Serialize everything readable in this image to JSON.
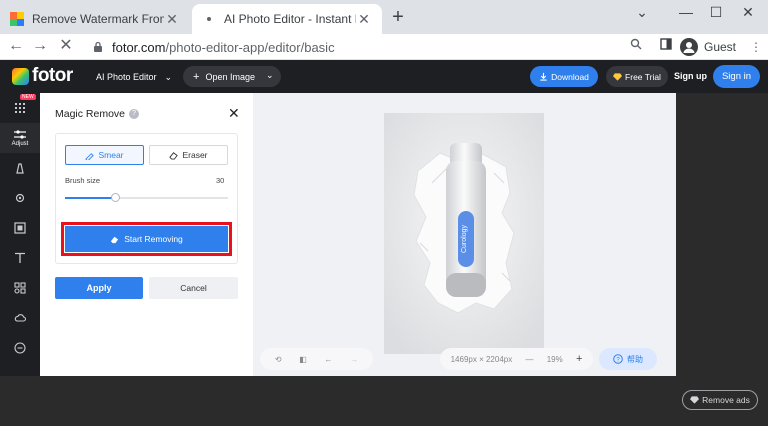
{
  "browser": {
    "tabs": [
      {
        "title": "Remove Watermark From Photo",
        "active": false
      },
      {
        "title": "AI Photo Editor - Instant Photo E",
        "active": true
      }
    ],
    "new_tab": "+",
    "window_controls": {
      "chevron": "⌄",
      "minimize": "—",
      "maximize": "☐",
      "close": "✕"
    },
    "address": {
      "host": "fotor.com",
      "path": "/photo-editor-app/editor/basic"
    },
    "profile_label": "Guest"
  },
  "app": {
    "logo_text": "fotor",
    "ai_editor_label": "AI Photo Editor",
    "open_image_label": "Open Image",
    "download_label": "Download",
    "free_trial_label": "Free Trial",
    "sign_up_label": "Sign up",
    "sign_in_label": "Sign in",
    "accent_color": "#2f80ed",
    "highlight_color": "#e8121e"
  },
  "rail": {
    "new_badge": "NEW",
    "adjust_label": "Adjust",
    "items": [
      "apps-icon",
      "adjust-icon",
      "beauty-icon",
      "effects-icon",
      "frames-icon",
      "text-icon",
      "elements-icon",
      "cloud-icon",
      "more-icon"
    ]
  },
  "panel": {
    "title": "Magic Remove",
    "help_glyph": "?",
    "close_glyph": "✕",
    "smear_label": "Smear",
    "eraser_label": "Eraser",
    "brush_size_label": "Brush size",
    "brush_size_value": "30",
    "brush_size_fraction": 0.31,
    "start_removing_label": "Start Removing",
    "apply_label": "Apply",
    "cancel_label": "Cancel"
  },
  "canvas": {
    "product_label": "Curology",
    "dimensions": "1469px × 2204px",
    "zoom_out": "—",
    "zoom_value": "19%",
    "zoom_in": "+",
    "help_label": "帮助"
  },
  "footer": {
    "remove_ads_label": "Remove ads"
  }
}
